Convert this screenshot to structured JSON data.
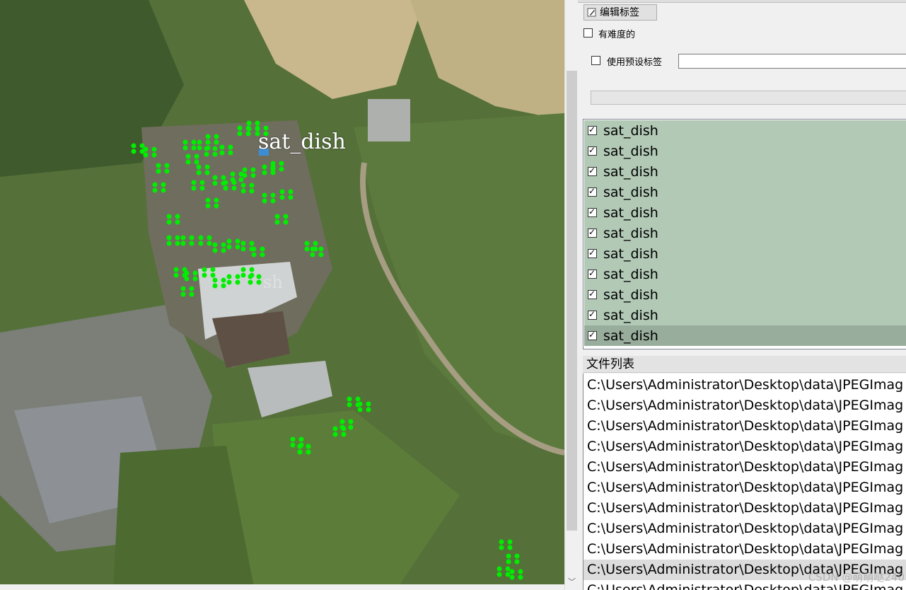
{
  "canvas": {
    "annotation_label": "sat_dish",
    "faint_labels": [
      "sh",
      "sh"
    ],
    "colors": {
      "point": "#00ee00",
      "selected_point": "#3b8ed6",
      "grass": "#4f6b36",
      "field": "#c7b891"
    }
  },
  "dock": {
    "edit_label_button": "编辑标签",
    "edit_icon": "pencil-edit-icon",
    "difficult_label": "有难度的",
    "difficult_checked": false,
    "use_preset_label": "使用预设标签",
    "use_preset_checked": false,
    "preset_value": "",
    "labels": [
      {
        "text": "sat_dish",
        "checked": true
      },
      {
        "text": "sat_dish",
        "checked": true
      },
      {
        "text": "sat_dish",
        "checked": true
      },
      {
        "text": "sat_dish",
        "checked": true
      },
      {
        "text": "sat_dish",
        "checked": true
      },
      {
        "text": "sat_dish",
        "checked": true
      },
      {
        "text": "sat_dish",
        "checked": true
      },
      {
        "text": "sat_dish",
        "checked": true
      },
      {
        "text": "sat_dish",
        "checked": true
      },
      {
        "text": "sat_dish",
        "checked": true
      },
      {
        "text": "sat_dish",
        "checked": true
      }
    ],
    "selected_label_index": 10,
    "file_list_title": "文件列表",
    "files": [
      "C:\\Users\\Administrator\\Desktop\\data\\JPEGImag",
      "C:\\Users\\Administrator\\Desktop\\data\\JPEGImag",
      "C:\\Users\\Administrator\\Desktop\\data\\JPEGImag",
      "C:\\Users\\Administrator\\Desktop\\data\\JPEGImag",
      "C:\\Users\\Administrator\\Desktop\\data\\JPEGImag",
      "C:\\Users\\Administrator\\Desktop\\data\\JPEGImag",
      "C:\\Users\\Administrator\\Desktop\\data\\JPEGImag",
      "C:\\Users\\Administrator\\Desktop\\data\\JPEGImag",
      "C:\\Users\\Administrator\\Desktop\\data\\JPEGImag",
      "C:\\Users\\Administrator\\Desktop\\data\\JPEGImag",
      "C:\\Users\\Administrator\\Desktop\\data\\JPEGImag"
    ],
    "selected_file_index": 9,
    "watermark": "CSDN @萌萌哒240"
  },
  "scrollbar": {
    "down_arrow": "﹀"
  }
}
